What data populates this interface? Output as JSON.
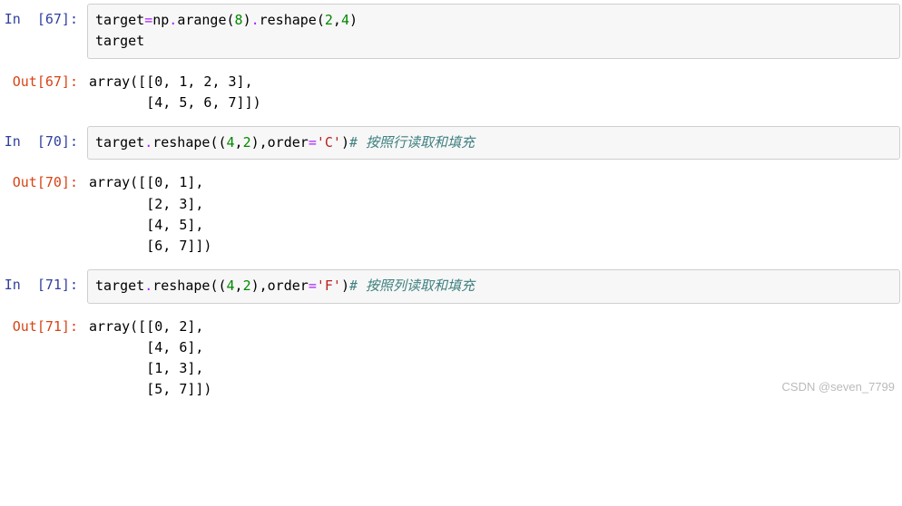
{
  "cells": [
    {
      "type": "in",
      "n": 67,
      "prompt": "In  [67]:",
      "code_tokens": [
        {
          "t": "target",
          "c": ""
        },
        {
          "t": "=",
          "c": "tok-op"
        },
        {
          "t": "np",
          "c": ""
        },
        {
          "t": ".",
          "c": "tok-op"
        },
        {
          "t": "arange",
          "c": ""
        },
        {
          "t": "(",
          "c": ""
        },
        {
          "t": "8",
          "c": "tok-num"
        },
        {
          "t": ")",
          "c": ""
        },
        {
          "t": ".",
          "c": "tok-op"
        },
        {
          "t": "reshape",
          "c": ""
        },
        {
          "t": "(",
          "c": ""
        },
        {
          "t": "2",
          "c": "tok-num"
        },
        {
          "t": ",",
          "c": ""
        },
        {
          "t": "4",
          "c": "tok-num"
        },
        {
          "t": ")",
          "c": ""
        },
        {
          "t": "\n",
          "c": ""
        },
        {
          "t": "target",
          "c": ""
        }
      ]
    },
    {
      "type": "out",
      "n": 67,
      "prompt": "Out[67]:",
      "text": "array([[0, 1, 2, 3],\n       [4, 5, 6, 7]])"
    },
    {
      "type": "in",
      "n": 70,
      "prompt": "In  [70]:",
      "code_tokens": [
        {
          "t": "target",
          "c": ""
        },
        {
          "t": ".",
          "c": "tok-op"
        },
        {
          "t": "reshape",
          "c": ""
        },
        {
          "t": "((",
          "c": ""
        },
        {
          "t": "4",
          "c": "tok-num"
        },
        {
          "t": ",",
          "c": ""
        },
        {
          "t": "2",
          "c": "tok-num"
        },
        {
          "t": "),",
          "c": ""
        },
        {
          "t": "order",
          "c": ""
        },
        {
          "t": "=",
          "c": "tok-op"
        },
        {
          "t": "'C'",
          "c": "tok-str"
        },
        {
          "t": ")",
          "c": ""
        },
        {
          "t": "# 按照行读取和填充",
          "c": "tok-comment"
        }
      ]
    },
    {
      "type": "out",
      "n": 70,
      "prompt": "Out[70]:",
      "text": "array([[0, 1],\n       [2, 3],\n       [4, 5],\n       [6, 7]])"
    },
    {
      "type": "in",
      "n": 71,
      "prompt": "In  [71]:",
      "code_tokens": [
        {
          "t": "target",
          "c": ""
        },
        {
          "t": ".",
          "c": "tok-op"
        },
        {
          "t": "reshape",
          "c": ""
        },
        {
          "t": "((",
          "c": ""
        },
        {
          "t": "4",
          "c": "tok-num"
        },
        {
          "t": ",",
          "c": ""
        },
        {
          "t": "2",
          "c": "tok-num"
        },
        {
          "t": "),",
          "c": ""
        },
        {
          "t": "order",
          "c": ""
        },
        {
          "t": "=",
          "c": "tok-op"
        },
        {
          "t": "'F'",
          "c": "tok-str"
        },
        {
          "t": ")",
          "c": ""
        },
        {
          "t": "# 按照列读取和填充",
          "c": "tok-comment"
        }
      ]
    },
    {
      "type": "out",
      "n": 71,
      "prompt": "Out[71]:",
      "text": "array([[0, 2],\n       [4, 6],\n       [1, 3],\n       [5, 7]])"
    }
  ],
  "watermark": "CSDN @seven_7799"
}
